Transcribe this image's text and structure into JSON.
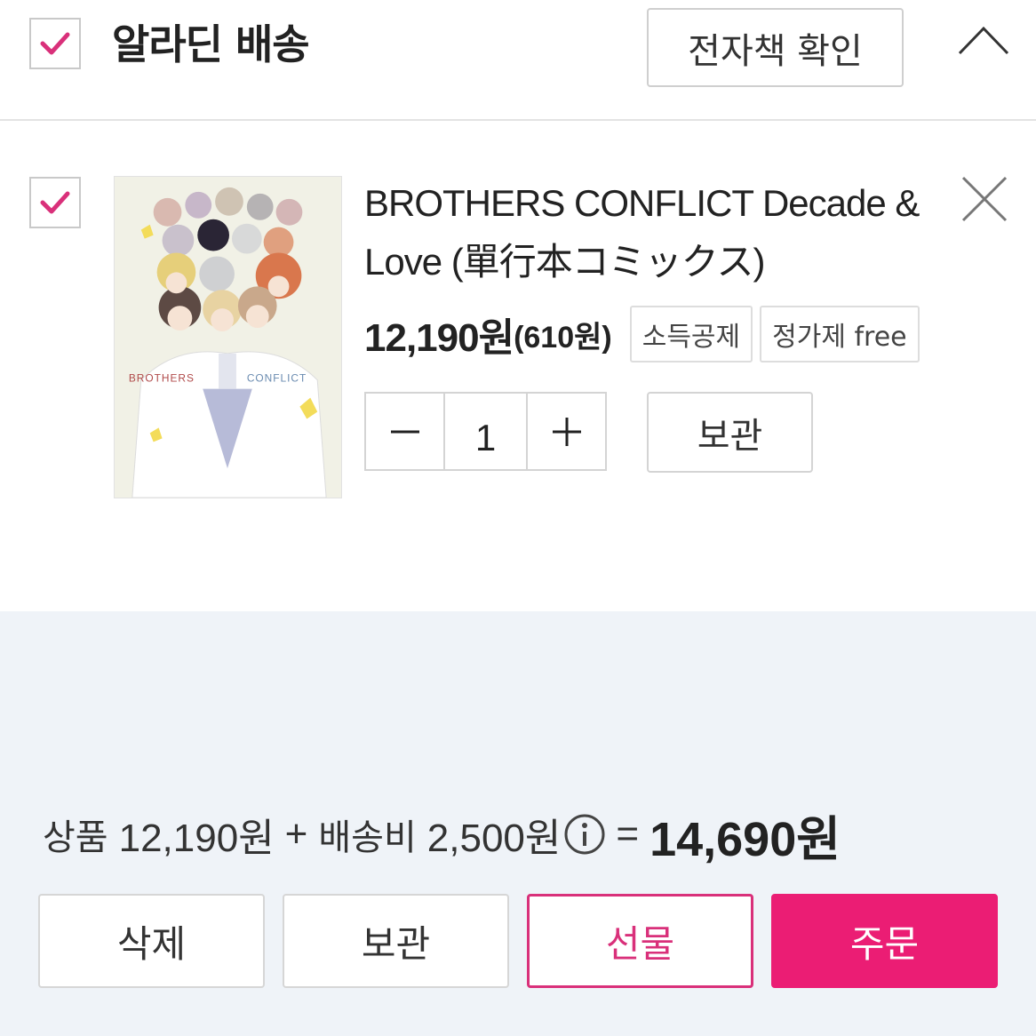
{
  "colors": {
    "accent": "#EB1D74",
    "check": "#D9307A",
    "summary_bg": "#EFF3F8"
  },
  "header": {
    "title": "알라딘 배송",
    "ebook_button": "전자책 확인",
    "collapse_icon": "chevron-up-icon",
    "selected": true
  },
  "item": {
    "selected": true,
    "title_line1": "BROTHERS CONFLICT Decade &",
    "title_line2": "Love (單行本コミックス)",
    "price": "12,190원",
    "point": "(610원)",
    "tags": [
      "소득공제",
      "정가제 free"
    ],
    "quantity": "1",
    "keep_button": "보관",
    "cover_texts": {
      "left": "BROTHERS",
      "right": "CONFLICT"
    }
  },
  "summary": {
    "products_label": "상품",
    "products_amount": "12,190원",
    "plus": "+",
    "shipping_label": "배송비",
    "shipping_amount": "2,500원",
    "equals": "=",
    "total": "14,690원"
  },
  "actions": {
    "delete": "삭제",
    "keep": "보관",
    "gift": "선물",
    "order": "주문"
  }
}
